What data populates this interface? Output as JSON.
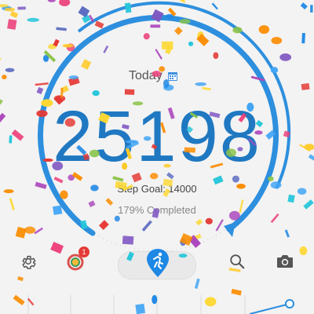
{
  "header": {
    "title": "Today"
  },
  "summary": {
    "steps": "25198",
    "goal_text": "Step Goal: 14000",
    "completed_text": "179% Completed",
    "progress_fraction": 1.79
  },
  "toolbar": {
    "settings_icon": "gear-icon",
    "badges_icon": "medal-icon",
    "badge_count": "1",
    "mode_icon": "running-person-icon",
    "search_icon": "search-icon",
    "camera_icon": "camera-icon"
  },
  "colors": {
    "accent": "#1f78c1",
    "arc": "#2d8fde",
    "badge": "#e53935",
    "background": "#f3f3f3"
  }
}
